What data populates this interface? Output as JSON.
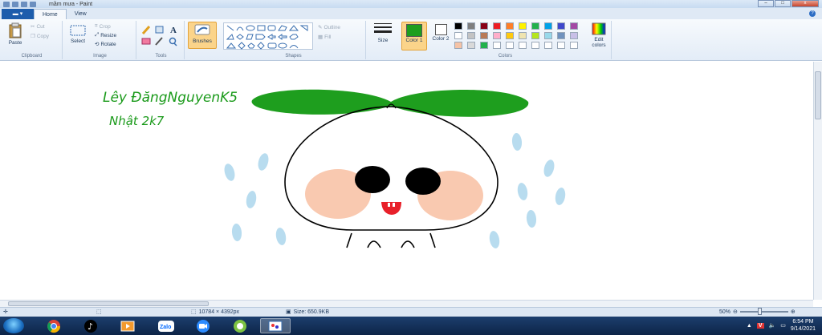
{
  "window": {
    "title": "mầm mưa - Paint",
    "minimize": "–",
    "maximize": "□",
    "close": "x"
  },
  "tabs": {
    "file": "",
    "home": "Home",
    "view": "View",
    "help": "?"
  },
  "clipboard": {
    "paste": "Paste",
    "cut": "Cut",
    "copy": "Copy",
    "group": "Clipboard"
  },
  "image": {
    "select": "Select",
    "crop": "Crop",
    "resize": "Resize",
    "rotate": "Rotate",
    "group": "Image"
  },
  "tools": {
    "group": "Tools"
  },
  "brushes": {
    "label": "Brushes"
  },
  "shapes": {
    "outline": "Outline",
    "fill": "Fill",
    "group": "Shapes"
  },
  "size": {
    "label": "Size"
  },
  "colors": {
    "color1_label": "Color 1",
    "color2_label": "Color 2",
    "edit": "Edit colors",
    "group": "Colors",
    "color1": "#1e9e1e",
    "color2": "#ffffff",
    "palette": [
      "#000000",
      "#7f7f7f",
      "#880015",
      "#ed1c24",
      "#ff7f27",
      "#fff200",
      "#22b14c",
      "#00a2e8",
      "#3f48cc",
      "#a349a4",
      "#ffffff",
      "#c3c3c3",
      "#b97a57",
      "#ffaec9",
      "#ffc90e",
      "#efe4b0",
      "#b5e61d",
      "#99d9ea",
      "#7092be",
      "#c8bfe7",
      "#f5c3a6",
      "#d9d9d9",
      "#22b14c",
      "#ffffff",
      "#ffffff",
      "#ffffff",
      "#ffffff",
      "#ffffff",
      "#ffffff",
      "#ffffff"
    ]
  },
  "canvas": {
    "handwriting_line1": "Lêy ĐăngNguyenK5",
    "handwriting_line2": "Nhật 2k7",
    "ink_color": "#1a9a1a",
    "sprout_color": "#1e9e1e",
    "cheek_color": "#f9c9b0",
    "drop_color": "#b8dcef",
    "mouth_color": "#e8202a"
  },
  "status": {
    "dimensions": "10784 × 4392px",
    "size": "Size: 650.9KB",
    "zoom": "50%"
  },
  "taskbar": {
    "apps": [
      "Chrome",
      "TikTok",
      "Media Player",
      "Zalo",
      "Zoom",
      "Vietnamese input",
      "Paint"
    ],
    "time": "6:54 PM",
    "date": "9/14/2021",
    "lang": "V"
  }
}
